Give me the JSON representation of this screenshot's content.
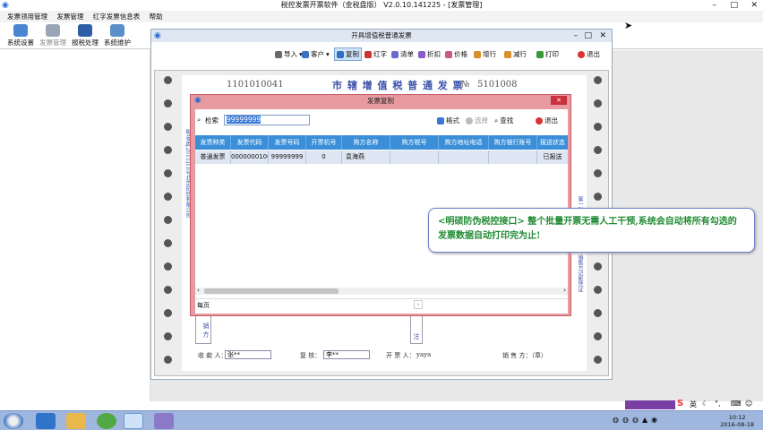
{
  "app": {
    "title": "税控发票开票软件（金税盘版） V2.0.10.141225 - [发票管理]",
    "menu": [
      "发票领用管理",
      "发票管理",
      "红字发票信息表",
      "帮助"
    ],
    "toolbar": [
      "系统设置",
      "发票管理",
      "报税处理",
      "系统维护"
    ]
  },
  "invoice_window": {
    "title": "开具增值税普通发票",
    "tools": [
      "导入",
      "客户",
      "复制",
      "红字",
      "清单",
      "折扣",
      "价格",
      "增行",
      "减行",
      "打印",
      "退出"
    ],
    "code_partial": "1101010041",
    "title_text": "市 辖 增 值 税 普 通 发 票",
    "no_label": "№",
    "no_partial": "5101008",
    "side_text": "税总函[2015]11号北京印钞有限公司",
    "stub_labels": [
      "第一联：记账联",
      "销售方记账凭证"
    ],
    "seller_block": "销 方",
    "remark_label": "注",
    "footer": {
      "payee_label": "收 款 人：",
      "payee_value": "张**",
      "reviewer_label": "复 核：",
      "reviewer_value": "李**",
      "issuer_label": "开 票 人：",
      "issuer_value": "yaya",
      "seller_label": "销 售 方：（章）"
    }
  },
  "dialog": {
    "title": "发票复制",
    "search_label": "检索",
    "search_value": "99999999",
    "format_label": "格式",
    "select_label": "选择",
    "find_label": "查找",
    "exit_label": "退出",
    "columns": [
      "发票种类",
      "发票代码",
      "发票号码",
      "开票机号",
      "购方名称",
      "购方税号",
      "购方地址电话",
      "购方银行账号",
      "报送状态"
    ],
    "rows": [
      [
        "普通发票",
        "0000000100",
        "99999999",
        "0",
        "袁海燕",
        "",
        "",
        "",
        "已报送"
      ]
    ],
    "pager": "每页"
  },
  "callout": {
    "text": "<明硕防伪税控接口> 整个批量开票无需人工干预,系统会自动将所有勾选的发票数据自动打印完为止!"
  },
  "taskbar": {
    "ime": "英",
    "time": "10:12",
    "date": "2016-08-18"
  },
  "colors": {
    "dialog_frame": "#e79ba1",
    "table_header": "#3a8fd8",
    "callout_text": "#1f8a33",
    "invoice_print": "#3a4ea8"
  }
}
